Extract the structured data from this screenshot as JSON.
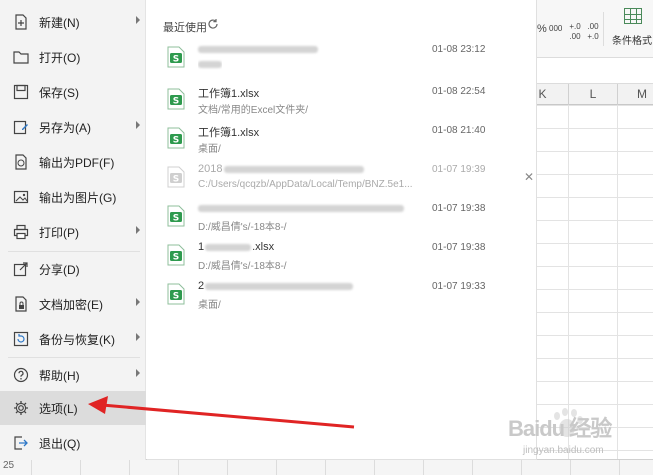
{
  "ribbon": {
    "percent_label": "%",
    "thousands_label": "000",
    "inc_decimal": "+.0 .00",
    "dec_decimal": ".00 +.0",
    "conditional_format_label": "条件格式"
  },
  "columns": [
    "K",
    "L",
    "M"
  ],
  "row_number": "25",
  "menu": {
    "items": [
      {
        "label": "新建(N)",
        "icon": "new-file-icon",
        "submenu": true
      },
      {
        "label": "打开(O)",
        "icon": "open-folder-icon",
        "submenu": false
      },
      {
        "label": "保存(S)",
        "icon": "save-icon",
        "submenu": false
      },
      {
        "label": "另存为(A)",
        "icon": "save-as-icon",
        "submenu": true
      },
      {
        "label": "输出为PDF(F)",
        "icon": "pdf-icon",
        "submenu": false
      },
      {
        "label": "输出为图片(G)",
        "icon": "image-icon",
        "submenu": false
      },
      {
        "label": "打印(P)",
        "icon": "print-icon",
        "submenu": true
      },
      {
        "label": "分享(D)",
        "icon": "share-icon",
        "submenu": false
      },
      {
        "label": "文档加密(E)",
        "icon": "encrypt-icon",
        "submenu": true
      },
      {
        "label": "备份与恢复(K)",
        "icon": "backup-icon",
        "submenu": true
      },
      {
        "label": "帮助(H)",
        "icon": "help-icon",
        "submenu": true
      },
      {
        "label": "选项(L)",
        "icon": "gear-icon",
        "submenu": false,
        "selected": true
      },
      {
        "label": "退出(Q)",
        "icon": "exit-icon",
        "submenu": false
      }
    ]
  },
  "recent": {
    "title": "最近使用",
    "files": [
      {
        "name": "",
        "path": "",
        "date": "01-08 23:12",
        "name_blurred": true,
        "path_blurred": true
      },
      {
        "name": "工作簿1.xlsx",
        "path": "文档/常用的Excel文件夹/",
        "date": "01-08 22:54"
      },
      {
        "name": "工作簿1.xlsx",
        "path": "桌面/",
        "date": "01-08 21:40"
      },
      {
        "name": "2018",
        "path": "C:/Users/qcqzb/AppData/Local/Temp/BNZ.5e1...",
        "date": "01-07 19:39",
        "dimmed": true,
        "name_blurred": true
      },
      {
        "name": "",
        "path": "D:/威昌倩's/-18本8-/",
        "date": "01-07 19:38",
        "name_blurred": true
      },
      {
        "name": "1",
        "name_suffix": ".xlsx",
        "path": "D:/威昌倩's/-18本8-/",
        "date": "01-07 19:38",
        "name_blurred": true
      },
      {
        "name": "2",
        "path": "桌面/",
        "date": "01-07 19:33",
        "name_blurred": true
      }
    ]
  },
  "watermark": {
    "text": "Baidu 经验",
    "url": "jingyan.baidu.com"
  },
  "colors": {
    "excel_green": "#2e9a4e",
    "arrow_red": "#e02424",
    "menu_bg": "#f3f3f3",
    "selected_bg": "#dcdcdc"
  }
}
